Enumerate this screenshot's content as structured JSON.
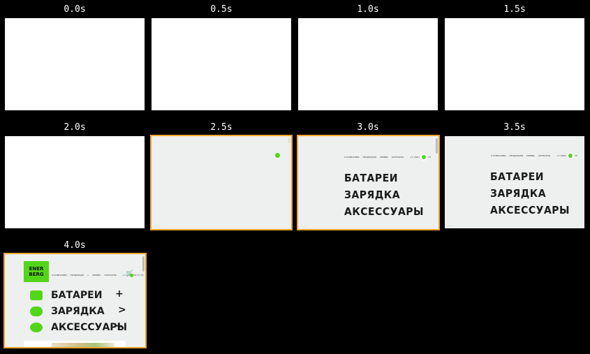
{
  "frames": [
    {
      "time": "0.0s"
    },
    {
      "time": "0.5s"
    },
    {
      "time": "1.0s"
    },
    {
      "time": "1.5s"
    },
    {
      "time": "2.0s"
    },
    {
      "time": "2.5s"
    },
    {
      "time": "3.0s"
    },
    {
      "time": "3.5s"
    },
    {
      "time": "4.0s"
    }
  ],
  "site": {
    "nav_items": [
      "О КОМПАНИИ",
      "ПРОДУКЦИЯ",
      "СЕРВИС",
      "КОНТАКТЫ"
    ],
    "nav_items_final": [
      "О КОМПАНИИ",
      "ПРОДУКЦИЯ",
      "+",
      "СЕРВИС",
      "КОНТАКТЫ"
    ],
    "phone": "+7 (495) 797-17-75",
    "menu": [
      "БАТАРЕИ",
      "ЗАРЯДКА",
      "АКСЕССУАРЫ"
    ],
    "menu_arrows": [
      "+",
      ">",
      "+"
    ],
    "logo_line1": "ENER",
    "logo_line2": "BERG",
    "accent_color": "#52d61a",
    "highlight_color": "#f0a32e"
  }
}
